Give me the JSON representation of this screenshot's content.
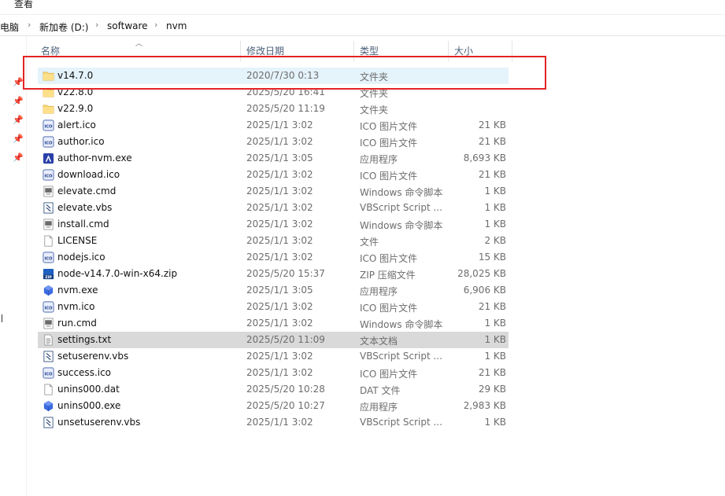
{
  "menu": {
    "view": "查看"
  },
  "breadcrumb": [
    "此电脑",
    "新加卷 (D:)",
    "software",
    "nvm"
  ],
  "columns": {
    "name": "名称",
    "date": "修改日期",
    "type": "类型",
    "size": "大小"
  },
  "files": [
    {
      "name": "v14.7.0",
      "date": "2020/7/30 0:13",
      "type": "文件夹",
      "size": "",
      "icon": "folder-icon"
    },
    {
      "name": "v22.8.0",
      "date": "2025/5/20 16:41",
      "type": "文件夹",
      "size": "",
      "icon": "folder-icon"
    },
    {
      "name": "v22.9.0",
      "date": "2025/5/20 11:19",
      "type": "文件夹",
      "size": "",
      "icon": "folder-icon"
    },
    {
      "name": "alert.ico",
      "date": "2025/1/1 3:02",
      "type": "ICO 图片文件",
      "size": "21 KB",
      "icon": "ico-file-icon"
    },
    {
      "name": "author.ico",
      "date": "2025/1/1 3:02",
      "type": "ICO 图片文件",
      "size": "21 KB",
      "icon": "ico-file-icon"
    },
    {
      "name": "author-nvm.exe",
      "date": "2025/1/1 3:05",
      "type": "应用程序",
      "size": "8,693 KB",
      "icon": "author-exe-icon"
    },
    {
      "name": "download.ico",
      "date": "2025/1/1 3:02",
      "type": "ICO 图片文件",
      "size": "21 KB",
      "icon": "ico-file-icon"
    },
    {
      "name": "elevate.cmd",
      "date": "2025/1/1 3:02",
      "type": "Windows 命令脚本",
      "size": "1 KB",
      "icon": "cmd-file-icon"
    },
    {
      "name": "elevate.vbs",
      "date": "2025/1/1 3:02",
      "type": "VBScript Script ...",
      "size": "1 KB",
      "icon": "vbs-file-icon"
    },
    {
      "name": "install.cmd",
      "date": "2025/1/1 3:02",
      "type": "Windows 命令脚本",
      "size": "1 KB",
      "icon": "cmd-file-icon"
    },
    {
      "name": "LICENSE",
      "date": "2025/1/1 3:02",
      "type": "文件",
      "size": "2 KB",
      "icon": "blank-file-icon"
    },
    {
      "name": "nodejs.ico",
      "date": "2025/1/1 3:02",
      "type": "ICO 图片文件",
      "size": "15 KB",
      "icon": "ico-file-icon"
    },
    {
      "name": "node-v14.7.0-win-x64.zip",
      "date": "2025/5/20 15:37",
      "type": "ZIP 压缩文件",
      "size": "28,025 KB",
      "icon": "zip-file-icon"
    },
    {
      "name": "nvm.exe",
      "date": "2025/1/1 3:05",
      "type": "应用程序",
      "size": "6,906 KB",
      "icon": "nvm-exe-icon"
    },
    {
      "name": "nvm.ico",
      "date": "2025/1/1 3:02",
      "type": "ICO 图片文件",
      "size": "21 KB",
      "icon": "ico-file-icon"
    },
    {
      "name": "run.cmd",
      "date": "2025/1/1 3:02",
      "type": "Windows 命令脚本",
      "size": "1 KB",
      "icon": "cmd-file-icon"
    },
    {
      "name": "settings.txt",
      "date": "2025/5/20 11:09",
      "type": "文本文档",
      "size": "1 KB",
      "icon": "txt-file-icon"
    },
    {
      "name": "setuserenv.vbs",
      "date": "2025/1/1 3:02",
      "type": "VBScript Script ...",
      "size": "1 KB",
      "icon": "vbs-file-icon"
    },
    {
      "name": "success.ico",
      "date": "2025/1/1 3:02",
      "type": "ICO 图片文件",
      "size": "21 KB",
      "icon": "ico-file-icon"
    },
    {
      "name": "unins000.dat",
      "date": "2025/5/20 10:28",
      "type": "DAT 文件",
      "size": "29 KB",
      "icon": "blank-file-icon"
    },
    {
      "name": "unins000.exe",
      "date": "2025/5/20 10:27",
      "type": "应用程序",
      "size": "2,983 KB",
      "icon": "nvm-exe-icon"
    },
    {
      "name": "unsetuserenv.vbs",
      "date": "2025/1/1 3:02",
      "type": "VBScript Script ...",
      "size": "1 KB",
      "icon": "vbs-file-icon"
    }
  ],
  "selected_index": 0,
  "hover_index": 16,
  "colors": {
    "selected": "#e5f3fb",
    "hover": "#d9d9d9",
    "annotation_box": "#e32424",
    "folder": "#f8d775"
  }
}
